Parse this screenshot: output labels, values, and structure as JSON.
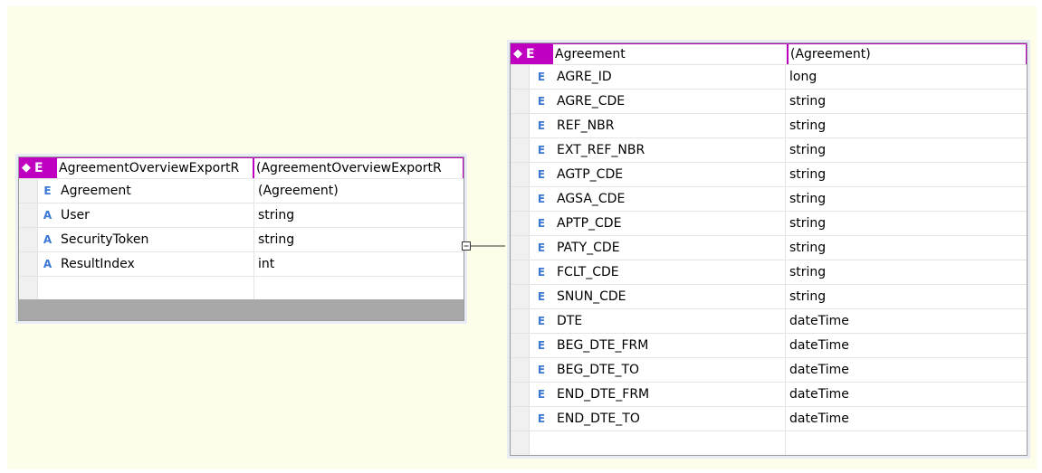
{
  "left_entity": {
    "kind_glyph": "E",
    "header_name": "AgreementOverviewExportR",
    "header_type": "(AgreementOverviewExportR",
    "rows": [
      {
        "kind": "E",
        "name": "Agreement",
        "type": "(Agreement)"
      },
      {
        "kind": "A",
        "name": "User",
        "type": "string"
      },
      {
        "kind": "A",
        "name": "SecurityToken",
        "type": "string"
      },
      {
        "kind": "A",
        "name": "ResultIndex",
        "type": "int"
      }
    ]
  },
  "right_entity": {
    "kind_glyph": "E",
    "header_name": "Agreement",
    "header_type": "(Agreement)",
    "rows": [
      {
        "kind": "E",
        "name": "AGRE_ID",
        "type": "long"
      },
      {
        "kind": "E",
        "name": "AGRE_CDE",
        "type": "string"
      },
      {
        "kind": "E",
        "name": "REF_NBR",
        "type": "string"
      },
      {
        "kind": "E",
        "name": "EXT_REF_NBR",
        "type": "string"
      },
      {
        "kind": "E",
        "name": "AGTP_CDE",
        "type": "string"
      },
      {
        "kind": "E",
        "name": "AGSA_CDE",
        "type": "string"
      },
      {
        "kind": "E",
        "name": "APTP_CDE",
        "type": "string"
      },
      {
        "kind": "E",
        "name": "PATY_CDE",
        "type": "string"
      },
      {
        "kind": "E",
        "name": "FCLT_CDE",
        "type": "string"
      },
      {
        "kind": "E",
        "name": "SNUN_CDE",
        "type": "string"
      },
      {
        "kind": "E",
        "name": "DTE",
        "type": "dateTime"
      },
      {
        "kind": "E",
        "name": "BEG_DTE_FRM",
        "type": "dateTime"
      },
      {
        "kind": "E",
        "name": "BEG_DTE_TO",
        "type": "dateTime"
      },
      {
        "kind": "E",
        "name": "END_DTE_FRM",
        "type": "dateTime"
      },
      {
        "kind": "E",
        "name": "END_DTE_TO",
        "type": "dateTime"
      }
    ]
  },
  "colors": {
    "canvas": "#fdfde9",
    "entity_header": "#c000c0",
    "element_glyph": "#3a78d4",
    "footer": "#a8a8a8"
  },
  "icons": {
    "entity_icon": "diamond-icon",
    "collapse_icon": "collapse-box-icon"
  }
}
